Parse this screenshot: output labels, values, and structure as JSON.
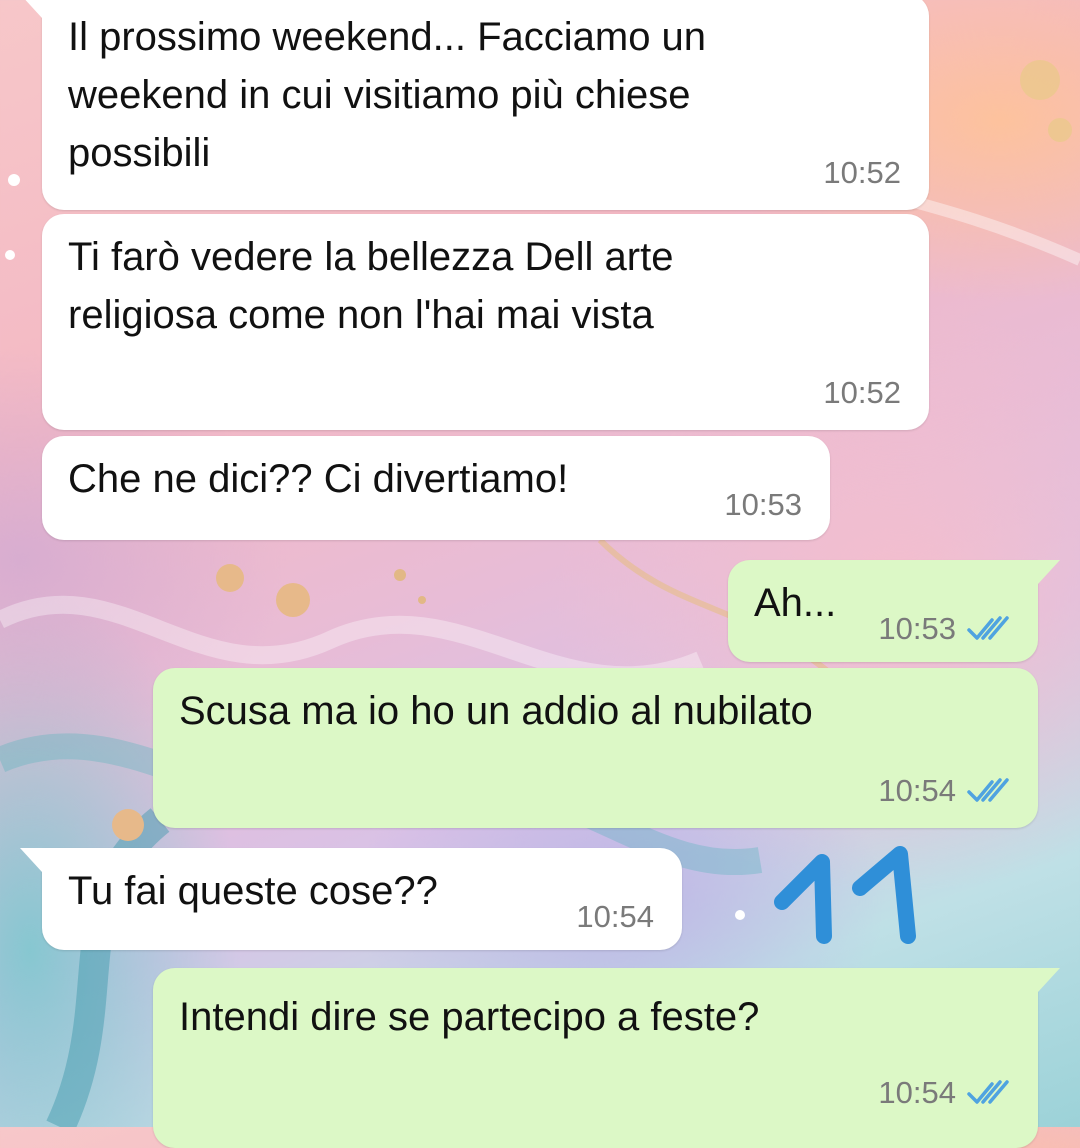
{
  "messages": [
    {
      "direction": "incoming",
      "text": "Il prossimo weekend... Facciamo un\nweekend in cui visitiamo più chiese\npossibili",
      "time": "10:52"
    },
    {
      "direction": "incoming",
      "text": "Ti farò vedere la bellezza Dell arte\nreligiosa come non l'hai mai vista",
      "time": "10:52"
    },
    {
      "direction": "incoming",
      "text": "Che ne dici?? Ci divertiamo!",
      "time": "10:53"
    },
    {
      "direction": "outgoing",
      "text": "Ah...",
      "time": "10:53",
      "status_icon": "double-check-read-icon"
    },
    {
      "direction": "outgoing",
      "text": "Scusa ma io ho un addio al nubilato",
      "time": "10:54",
      "status_icon": "double-check-read-icon"
    },
    {
      "direction": "incoming",
      "text": "Tu fai queste cose??",
      "time": "10:54"
    },
    {
      "direction": "outgoing",
      "text": "Intendi dire se partecipo a feste?",
      "time": "10:54",
      "status_icon": "double-check-read-icon"
    }
  ],
  "annotation": {
    "text": "11",
    "color": "#2f8fd8"
  },
  "colors": {
    "incoming_bubble": "#ffffff",
    "outgoing_bubble": "#dcf8c6",
    "read_checks": "#4fa3e0",
    "timestamp": "#7a7a7a"
  }
}
